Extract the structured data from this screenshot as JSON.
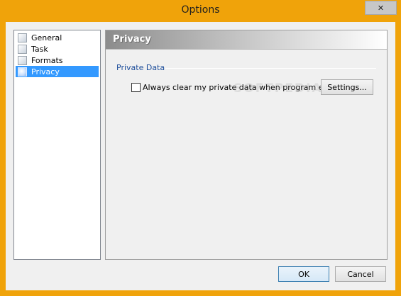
{
  "window": {
    "title": "Options",
    "close_glyph": "✕"
  },
  "tree": {
    "items": [
      {
        "label": "General",
        "icon": "general-icon",
        "selected": false
      },
      {
        "label": "Task",
        "icon": "task-icon",
        "selected": false
      },
      {
        "label": "Formats",
        "icon": "formats-icon",
        "selected": false
      },
      {
        "label": "Privacy",
        "icon": "privacy-icon",
        "selected": true
      }
    ]
  },
  "panel": {
    "title": "Privacy",
    "group_label": "Private Data",
    "checkbox": {
      "label": "Always clear my private data when program exits",
      "checked": false
    },
    "settings_button": "Settings..."
  },
  "footer": {
    "ok": "OK",
    "cancel": "Cancel"
  },
  "watermark": "SOFTPEDIA",
  "colors": {
    "titlebar": "#f0a30a",
    "selection": "#3399ff",
    "group_label": "#1f4f9c"
  }
}
